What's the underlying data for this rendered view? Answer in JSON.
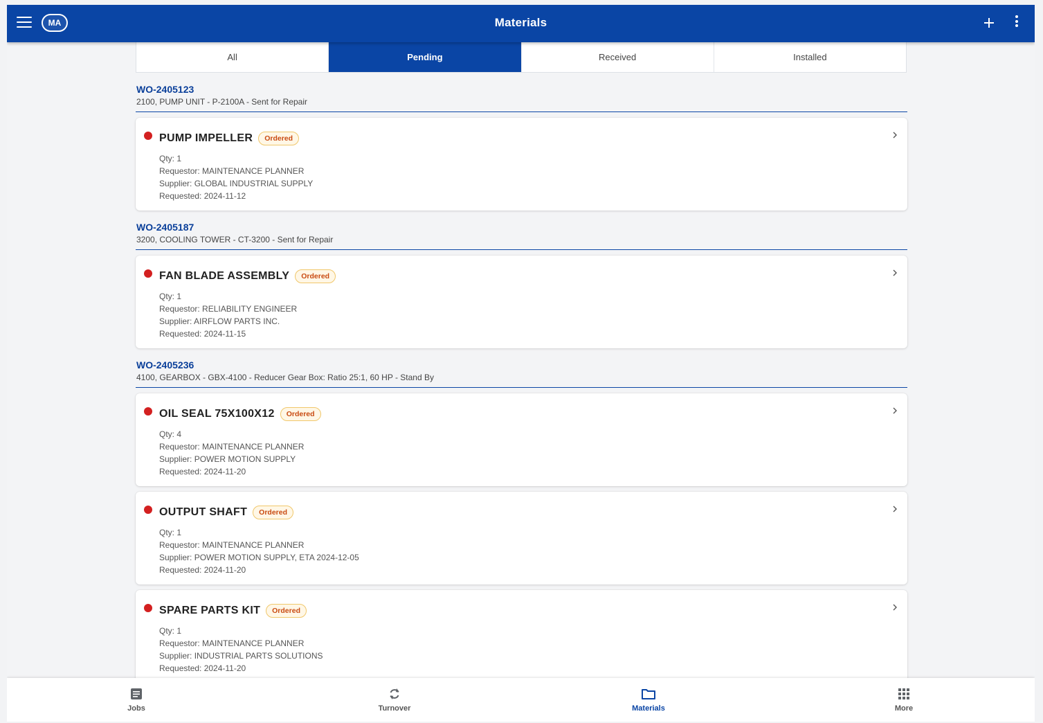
{
  "app": {
    "title": "Materials",
    "avatar_initials": "MA",
    "accent_color": "#0a45a5"
  },
  "tabs": [
    {
      "label": "All",
      "active": false
    },
    {
      "label": "Pending",
      "active": true
    },
    {
      "label": "Received",
      "active": false
    },
    {
      "label": "Installed",
      "active": false
    }
  ],
  "groups": [
    {
      "wo": "WO-2405123",
      "desc": "2100, PUMP UNIT - P-2100A - Sent for Repair",
      "items": [
        {
          "name": "PUMP IMPELLER",
          "status": "Ordered",
          "qty": "Qty: 1",
          "requestor": "Requestor: MAINTENANCE PLANNER",
          "supplier": "Supplier: GLOBAL INDUSTRIAL SUPPLY",
          "requested": "Requested: 2024-11-12"
        }
      ]
    },
    {
      "wo": "WO-2405187",
      "desc": "3200, COOLING TOWER - CT-3200 - Sent for Repair",
      "items": [
        {
          "name": "FAN BLADE ASSEMBLY",
          "status": "Ordered",
          "qty": "Qty: 1",
          "requestor": "Requestor: RELIABILITY ENGINEER",
          "supplier": "Supplier: AIRFLOW PARTS INC.",
          "requested": "Requested: 2024-11-15"
        }
      ]
    },
    {
      "wo": "WO-2405236",
      "desc": "4100, GEARBOX - GBX-4100 - Reducer Gear Box: Ratio 25:1, 60 HP - Stand By",
      "items": [
        {
          "name": "OIL SEAL 75X100X12",
          "status": "Ordered",
          "qty": "Qty: 4",
          "requestor": "Requestor: MAINTENANCE PLANNER",
          "supplier": "Supplier: POWER MOTION SUPPLY",
          "requested": "Requested: 2024-11-20"
        },
        {
          "name": "OUTPUT SHAFT",
          "status": "Ordered",
          "qty": "Qty: 1",
          "requestor": "Requestor: MAINTENANCE PLANNER",
          "supplier": "Supplier: POWER MOTION SUPPLY, ETA 2024-12-05",
          "requested": "Requested: 2024-11-20"
        },
        {
          "name": "SPARE PARTS KIT",
          "status": "Ordered",
          "qty": "Qty: 1",
          "requestor": "Requestor: MAINTENANCE PLANNER",
          "supplier": "Supplier: INDUSTRIAL PARTS SOLUTIONS",
          "requested": "Requested: 2024-11-20"
        }
      ]
    }
  ],
  "bottom_nav": [
    {
      "label": "Jobs",
      "icon": "document-icon",
      "active": false
    },
    {
      "label": "Turnover",
      "icon": "sync-icon",
      "active": false
    },
    {
      "label": "Materials",
      "icon": "folder-icon",
      "active": true
    },
    {
      "label": "More",
      "icon": "grid-icon",
      "active": false
    }
  ]
}
